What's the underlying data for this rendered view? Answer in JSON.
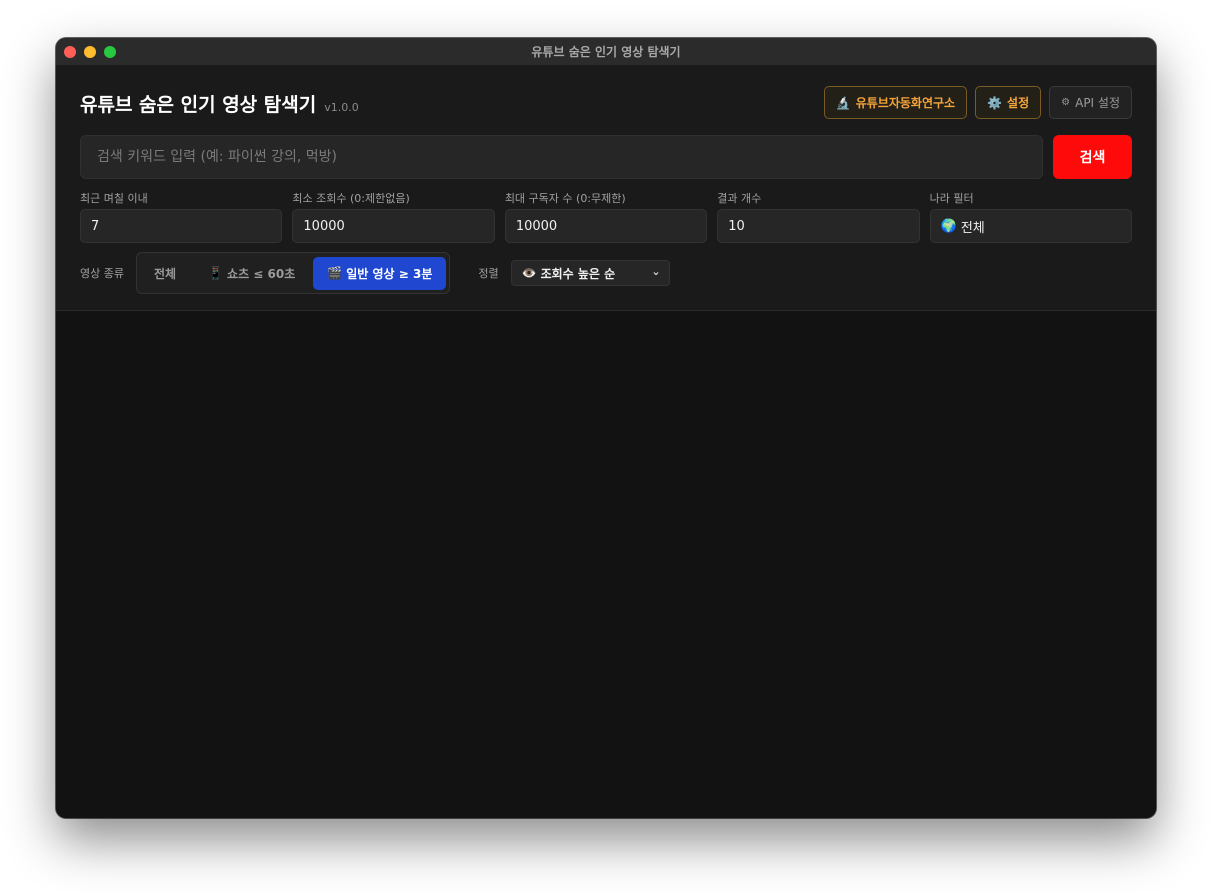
{
  "window": {
    "title": "유튜브 숨은 인기 영상 탐색기"
  },
  "header": {
    "app_name": "유튜브 숨은 인기 영상 탐색기",
    "version": "v1.0.0",
    "lab_button": "유튜브자동화연구소",
    "lab_icon": "🔬",
    "settings_button": "설정",
    "settings_icon": "⚙️",
    "api_button": "API 설정",
    "api_icon": "⚙"
  },
  "search": {
    "placeholder": "검색 키워드 입력 (예: 파이썬 강의, 먹방)",
    "value": "",
    "button": "검색"
  },
  "filters": [
    {
      "label": "최근 며칠 이내",
      "value": "7"
    },
    {
      "label": "최소 조회수 (0:제한없음)",
      "value": "10000"
    },
    {
      "label": "최대 구독자 수 (0:무제한)",
      "value": "10000"
    },
    {
      "label": "결과 개수",
      "value": "10"
    },
    {
      "label": "나라 필터",
      "value": "전체",
      "icon": "🌍"
    }
  ],
  "video_type": {
    "label": "영상 종류",
    "options": [
      {
        "label": "전체",
        "icon": ""
      },
      {
        "label": "쇼츠 ≤ 60초",
        "icon": "📱"
      },
      {
        "label": "일반 영상 ≥ 3분",
        "icon": "🎬"
      }
    ],
    "selected_index": 2
  },
  "sort": {
    "label": "정렬",
    "selected": "조회수 높은 순",
    "icon": "👁️"
  },
  "colors": {
    "accent_blue": "#1f47d0",
    "search_red": "#ff0a0a",
    "orange": "#f5a43a"
  }
}
